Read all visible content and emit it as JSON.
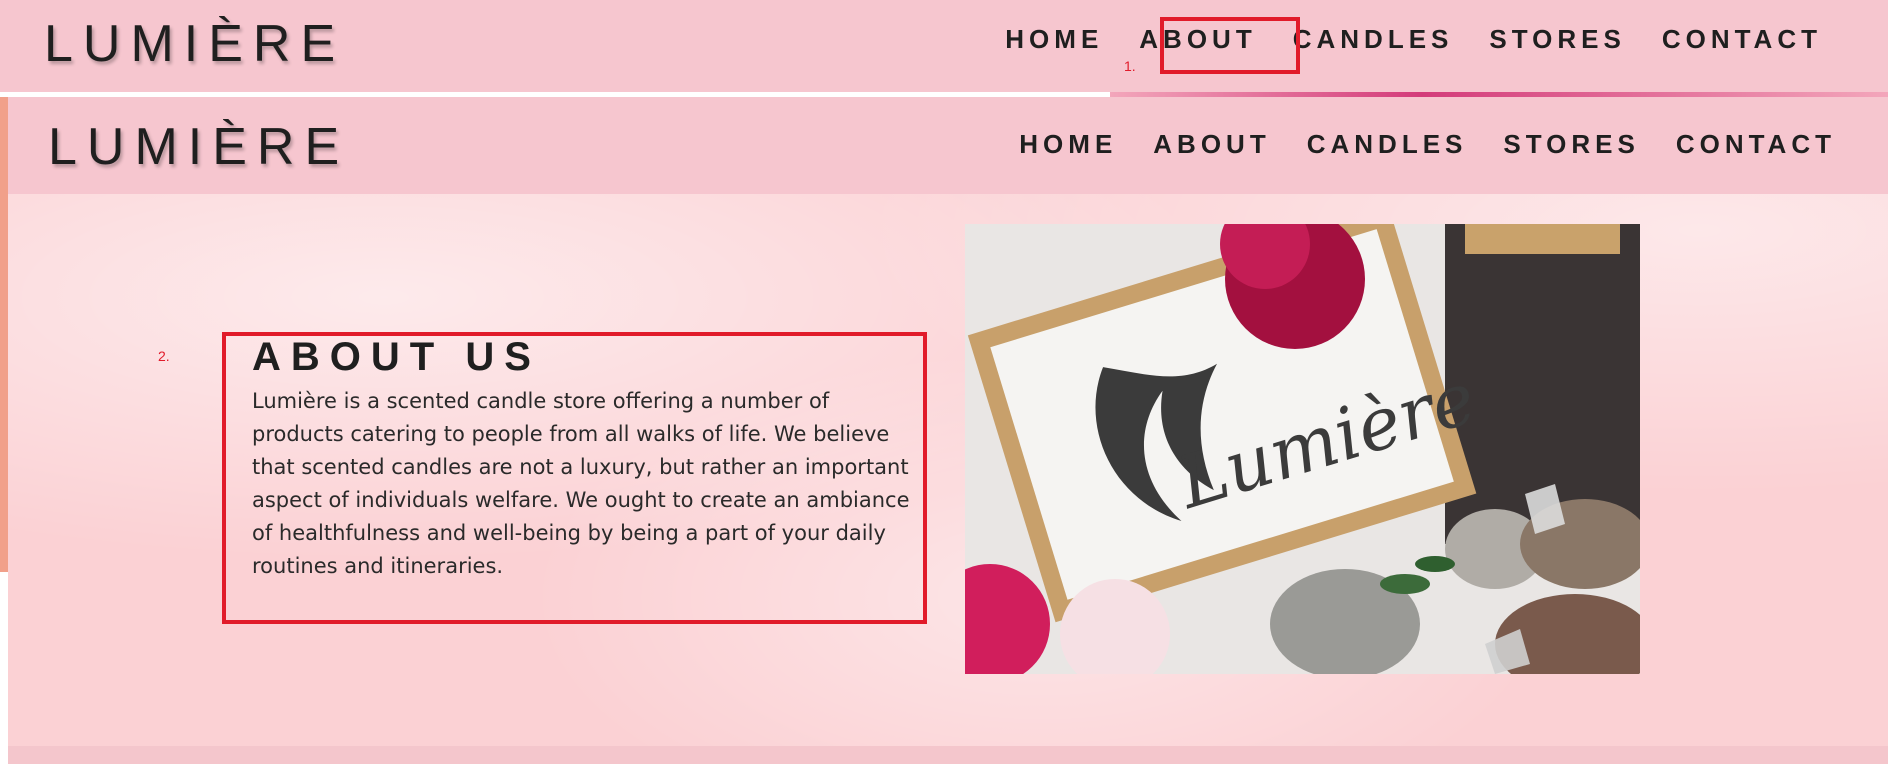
{
  "top_nav": {
    "logo": "LUMIÈRE",
    "links": [
      "HOME",
      "ABOUT",
      "CANDLES",
      "STORES",
      "CONTACT"
    ]
  },
  "annotations": {
    "first": "1.",
    "second": "2."
  },
  "second_nav": {
    "logo": "LUMIÈRE",
    "links": [
      "HOME",
      "ABOUT",
      "CANDLES",
      "STORES",
      "CONTACT"
    ]
  },
  "about": {
    "title": "ABOUT US",
    "body": "Lumière is a scented candle store offering a number of products catering to people from all walks of life. We believe that scented candles are not a luxury, but rather an important aspect of individuals welfare. We ought to create an ambiance of healthfulness and well-being by being a part of your daily routines and itineraries."
  },
  "photo": {
    "card_text": "Lumière"
  },
  "colors": {
    "nav_bg": "#f6c6cf",
    "page_bg": "#fbd1d4",
    "annotation": "#e11b2a",
    "text": "#1f1f1f"
  }
}
